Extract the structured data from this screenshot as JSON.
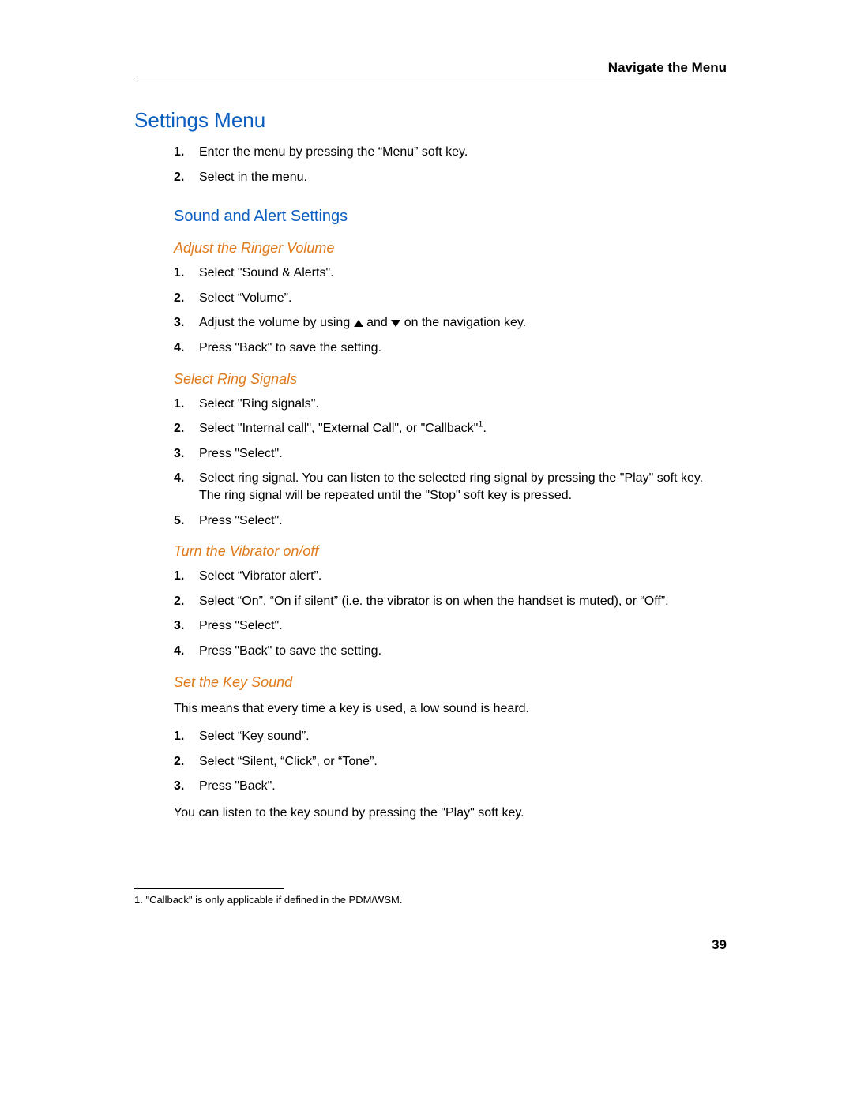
{
  "header": {
    "right": "Navigate the Menu"
  },
  "title": "Settings Menu",
  "intro_steps": [
    "Enter the menu by pressing the “Menu” soft key.",
    "Select       in the menu."
  ],
  "h2_sound": "Sound and Alert Settings",
  "sec_ringer": {
    "title": "Adjust the Ringer Volume",
    "steps": {
      "1": "Select \"Sound & Alerts\".",
      "2": "Select “Volume”.",
      "3a": "Adjust the volume by using ",
      "3b": " and ",
      "3c": " on the navigation key.",
      "4": "Press \"Back\" to save the setting."
    }
  },
  "sec_ring_signals": {
    "title": "Select Ring Signals",
    "steps": {
      "1": "Select \"Ring signals\".",
      "2a": "Select \"Internal call\", \"External Call\", or \"Callback\"",
      "2sup": "1",
      "2b": ".",
      "3": "Press \"Select\".",
      "4": "Select ring signal. You can listen to the selected ring signal by pressing the \"Play\" soft key. The ring signal will be repeated until the \"Stop\" soft key is pressed.",
      "5": "Press \"Select\"."
    }
  },
  "sec_vibrator": {
    "title": "Turn the Vibrator on/off",
    "steps": [
      "Select “Vibrator alert”.",
      "Select “On”, “On if silent” (i.e. the vibrator is on when the handset is muted), or “Off”.",
      "Press \"Select\".",
      "Press \"Back\" to save the setting."
    ]
  },
  "sec_keysound": {
    "title": "Set the Key Sound",
    "lead": "This means that every time a key is used, a low sound is heard.",
    "steps": [
      "Select “Key sound”.",
      "Select “Silent, “Click”, or “Tone”.",
      "Press \"Back\"."
    ],
    "trail": "You can listen to the key sound by pressing the \"Play\" soft key."
  },
  "footnote": "1.  \"Callback\" is only applicable if defined in the PDM/WSM.",
  "pagenum": "39",
  "nums": {
    "1": "1.",
    "2": "2.",
    "3": "3.",
    "4": "4.",
    "5": "5."
  }
}
